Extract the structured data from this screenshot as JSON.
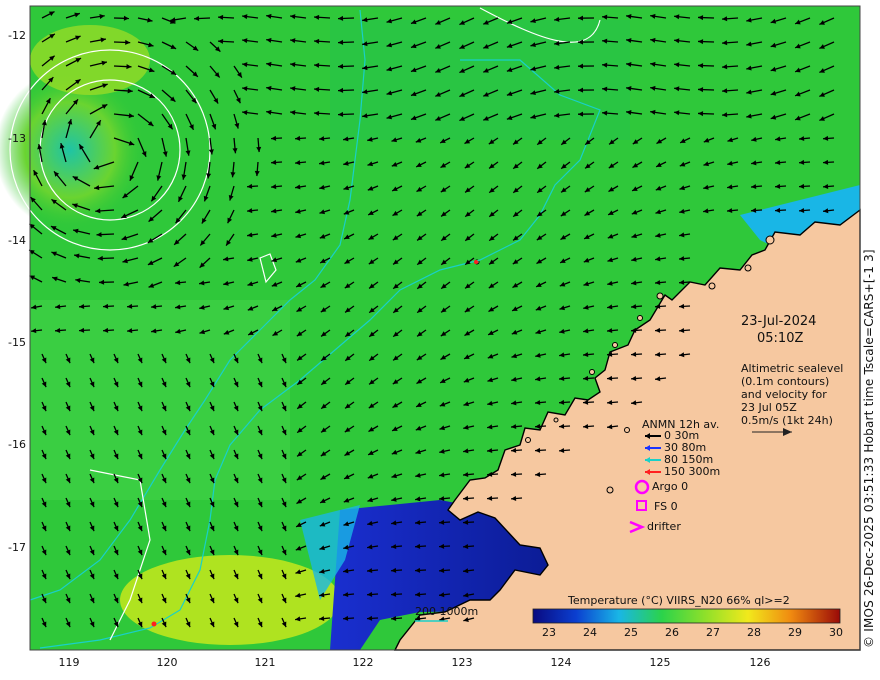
{
  "map": {
    "lon_ticks": [
      "119",
      "120",
      "121",
      "122",
      "123",
      "124",
      "125",
      "126"
    ],
    "lat_ticks": [
      "-12",
      "-13",
      "-14",
      "-15",
      "-16",
      "-17"
    ],
    "date": "23-Jul-2024",
    "time": "05:10Z",
    "info_lines": [
      "Altimetric sealevel",
      "(0.1m contours)",
      "and velocity for",
      "23 Jul 05Z",
      "0.5m/s (1kt 24h)"
    ],
    "anmn": {
      "title": "ANMN 12h av.",
      "items": [
        {
          "label": "0 30m",
          "color": "#000000"
        },
        {
          "label": "30 80m",
          "color": "#1a33ff"
        },
        {
          "label": "80 150m",
          "color": "#19d0c8"
        },
        {
          "label": "150 300m",
          "color": "#ff2020"
        }
      ]
    },
    "symbols": {
      "argo": "Argo 0",
      "fs": "FS 0",
      "drifter": "drifter"
    },
    "isobath": "200  1000m",
    "colorbar": {
      "title": "Temperature (°C) VIIRS_N20 66% ql>=2",
      "ticks": [
        "23",
        "24",
        "25",
        "26",
        "27",
        "28",
        "29",
        "30"
      ]
    },
    "credit": "© IMOS 26-Dec-2025 03:51:33 Hobart time Tscale=CARS+[-1 3]",
    "colors": {
      "land": "#f6c8a0",
      "sea_warm": "#2fc83a",
      "sea_cool": "#1a4fd8",
      "magenta": "#ff00ff",
      "contour_cyan": "#19d0c8"
    }
  }
}
